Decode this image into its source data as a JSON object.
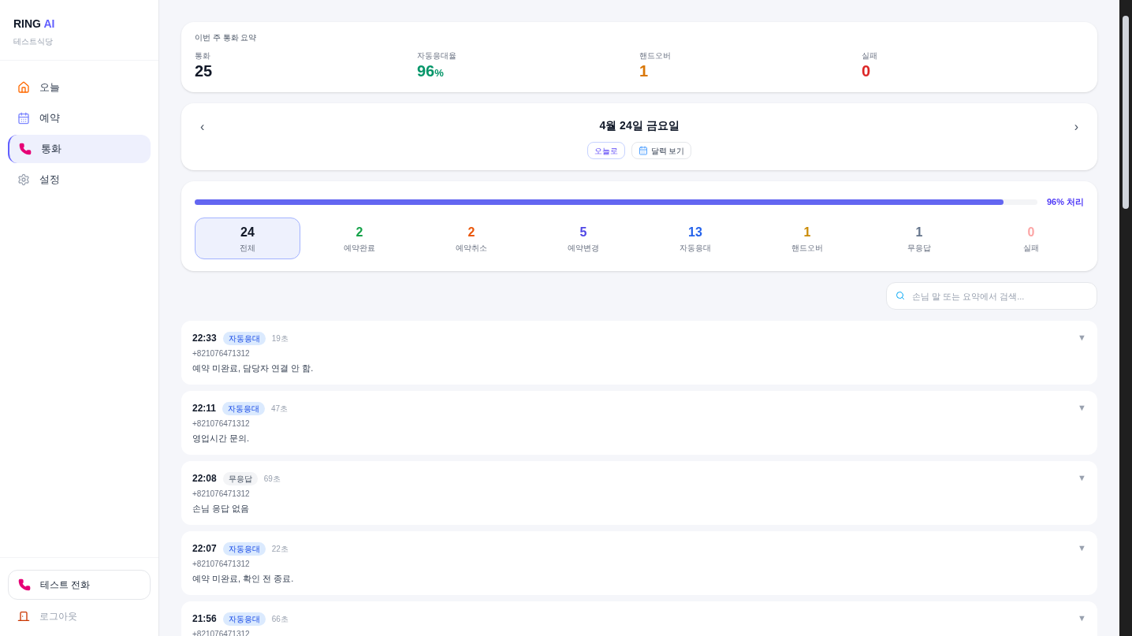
{
  "brand": {
    "name": "RING",
    "accent": "AI",
    "subtitle": "테스트식당"
  },
  "nav": [
    {
      "label": "오늘",
      "selected": false
    },
    {
      "label": "예약",
      "selected": false
    },
    {
      "label": "통화",
      "selected": true
    },
    {
      "label": "설정",
      "selected": false
    }
  ],
  "test_call": {
    "label": "테스트 전화"
  },
  "logout": {
    "label": "로그아웃"
  },
  "summary": {
    "title": "이번 주 통화 요약",
    "stats": [
      {
        "label": "통화",
        "value": "25",
        "color": "#111827"
      },
      {
        "label": "자동응대율",
        "value": "96",
        "unit": "%",
        "color": "#059669"
      },
      {
        "label": "핸드오버",
        "value": "1",
        "color": "#d97706"
      },
      {
        "label": "실패",
        "value": "0",
        "color": "#dc2626"
      }
    ]
  },
  "date_nav": {
    "prev": "‹",
    "next": "›",
    "date": "4월 24일 금요일",
    "today_button": "오늘로",
    "calendar_button": "달력 보기"
  },
  "progress": {
    "level": 0.96,
    "label": "96% 처리"
  },
  "filters": [
    {
      "count": "24",
      "label": "전체",
      "color": "#111827",
      "selected": true
    },
    {
      "count": "2",
      "label": "예약완료",
      "color": "#16a34a",
      "selected": false
    },
    {
      "count": "2",
      "label": "예약취소",
      "color": "#ea580c",
      "selected": false
    },
    {
      "count": "5",
      "label": "예약변경",
      "color": "#4f46e5",
      "selected": false
    },
    {
      "count": "13",
      "label": "자동응대",
      "color": "#2563eb",
      "selected": false
    },
    {
      "count": "1",
      "label": "핸드오버",
      "color": "#ca8a04",
      "selected": false
    },
    {
      "count": "1",
      "label": "무응답",
      "color": "#64748b",
      "selected": false
    },
    {
      "count": "0",
      "label": "실패",
      "color": "#fca5a5",
      "selected": false
    }
  ],
  "search": {
    "placeholder": "손님 말 또는 요약에서 검색..."
  },
  "calls": [
    {
      "time": "22:33",
      "tag": "자동응대",
      "kind": "auto",
      "duration": "19초",
      "phone": "+821076471312",
      "summary": "예약 미완료, 담당자 연결 안 함.",
      "toggle": "▼"
    },
    {
      "time": "22:11",
      "tag": "자동응대",
      "kind": "auto",
      "duration": "47초",
      "phone": "+821076471312",
      "summary": "영업시간 문의.",
      "toggle": "▼"
    },
    {
      "time": "22:08",
      "tag": "무응답",
      "kind": "noanswer",
      "duration": "69초",
      "phone": "+821076471312",
      "summary": "손님 응답 없음",
      "toggle": "▼"
    },
    {
      "time": "22:07",
      "tag": "자동응대",
      "kind": "auto",
      "duration": "22초",
      "phone": "+821076471312",
      "summary": "예약 미완료, 확인 전 종료.",
      "toggle": "▼"
    },
    {
      "time": "21:56",
      "tag": "자동응대",
      "kind": "auto",
      "duration": "66초",
      "phone": "+821076471312",
      "toggle": "▼"
    }
  ]
}
